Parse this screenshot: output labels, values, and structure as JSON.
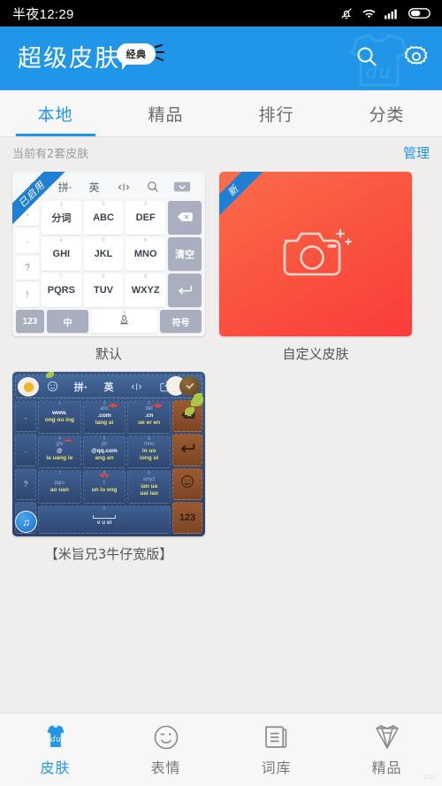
{
  "statusbar": {
    "clock": "半夜12:29",
    "icons": [
      "bell-muted-icon",
      "wifi-icon",
      "signal-icon",
      "battery-icon"
    ]
  },
  "header": {
    "title": "超级皮肤",
    "badge": "经典",
    "search_icon": "search-icon",
    "settings_icon": "gear-icon",
    "bg_color": "#2196e8"
  },
  "tabs": [
    {
      "label": "本地",
      "active": true
    },
    {
      "label": "精品",
      "active": false
    },
    {
      "label": "排行",
      "active": false
    },
    {
      "label": "分类",
      "active": false
    }
  ],
  "subbar": {
    "count_text": "当前有2套皮肤",
    "manage_label": "管理",
    "manage_color": "#2196e8"
  },
  "skins": [
    {
      "name": "默认",
      "ribbon": "已启用",
      "ribbon_color": "#1f7fd4",
      "type": "default-keyboard-preview"
    },
    {
      "name": "自定义皮肤",
      "ribbon": "新",
      "ribbon_color": "#1f7fd4",
      "type": "custom-camera-card",
      "card_color": "#f9563f",
      "icon": "camera-icon"
    },
    {
      "name": "【米旨兄3牛仔宽版】",
      "ribbon": "",
      "type": "denim-keyboard-preview"
    }
  ],
  "default_keyboard": {
    "toolbar": [
      "smiley-icon",
      "拼·",
      "英",
      "中英切换",
      "search-icon",
      "collapse-icon"
    ],
    "left_column": [
      ",",
      ".",
      "?",
      "!"
    ],
    "rows": [
      [
        {
          "num": "1",
          "label": "分词"
        },
        {
          "num": "2",
          "label": "ABC"
        },
        {
          "num": "3",
          "label": "DEF"
        }
      ],
      [
        {
          "num": "4",
          "label": "GHI"
        },
        {
          "num": "5",
          "label": "JKL"
        },
        {
          "num": "6",
          "label": "MNO"
        }
      ],
      [
        {
          "num": "7",
          "label": "PQRS"
        },
        {
          "num": "8",
          "label": "TUV"
        },
        {
          "num": "9",
          "label": "WXYZ"
        }
      ]
    ],
    "right_column": [
      "backspace-icon",
      "清空",
      "enter-icon"
    ],
    "bottom_row": [
      "123",
      "中",
      "mic-icon",
      "符号"
    ]
  },
  "denim_keyboard": {
    "toolbar": [
      "cat-avatar-icon",
      "smiley-icon",
      "拼·",
      "英",
      "中英切换",
      "share-icon",
      "rabbit-icon",
      "knob-icon"
    ],
    "left_column": [
      ",",
      ".",
      "?",
      "!"
    ],
    "rows": [
      [
        {
          "num": "1",
          "latin": "",
          "web": "www.",
          "pinyin": "ong ou ing"
        },
        {
          "num": "2",
          "latin": "abc",
          "web": ".com",
          "pinyin": "iang ai"
        },
        {
          "num": "3",
          "latin": "def",
          "web": ".cn",
          "pinyin": "ue er en"
        }
      ],
      [
        {
          "num": "4",
          "latin": "ghi",
          "web": "@",
          "pinyin": "ia uang ie"
        },
        {
          "num": "5",
          "latin": "jkl",
          "web": "@qq.com",
          "pinyin": "ang an"
        },
        {
          "num": "6",
          "latin": "mno",
          "web": "in uo",
          "pinyin": "iong ui"
        }
      ],
      [
        {
          "num": "7",
          "latin": "pqrs",
          "web": "",
          "pinyin": "ao uan"
        },
        {
          "num": "8",
          "latin": "t",
          "web": "",
          "pinyin": "un iu eng"
        },
        {
          "num": "9",
          "latin": "wxyz",
          "web": "ian ua",
          "pinyin": "uai iao"
        }
      ]
    ],
    "space_row": {
      "num": "0",
      "pinyin": "v u ei"
    },
    "right_column": [
      "backspace-icon",
      "enter-icon",
      "smiley-icon",
      "123"
    ],
    "music_icon": "music-note-icon"
  },
  "bottom_nav": [
    {
      "label": "皮肤",
      "icon": "shirt-du-icon",
      "active": true
    },
    {
      "label": "表情",
      "icon": "smiley-icon",
      "active": false
    },
    {
      "label": "词库",
      "icon": "document-icon",
      "active": false
    },
    {
      "label": "精品",
      "icon": "diamond-icon",
      "active": false
    }
  ],
  "theme": {
    "accent": "#2196e8",
    "page_bg": "#efeeed",
    "nav_bg": "#f7f7f7"
  }
}
